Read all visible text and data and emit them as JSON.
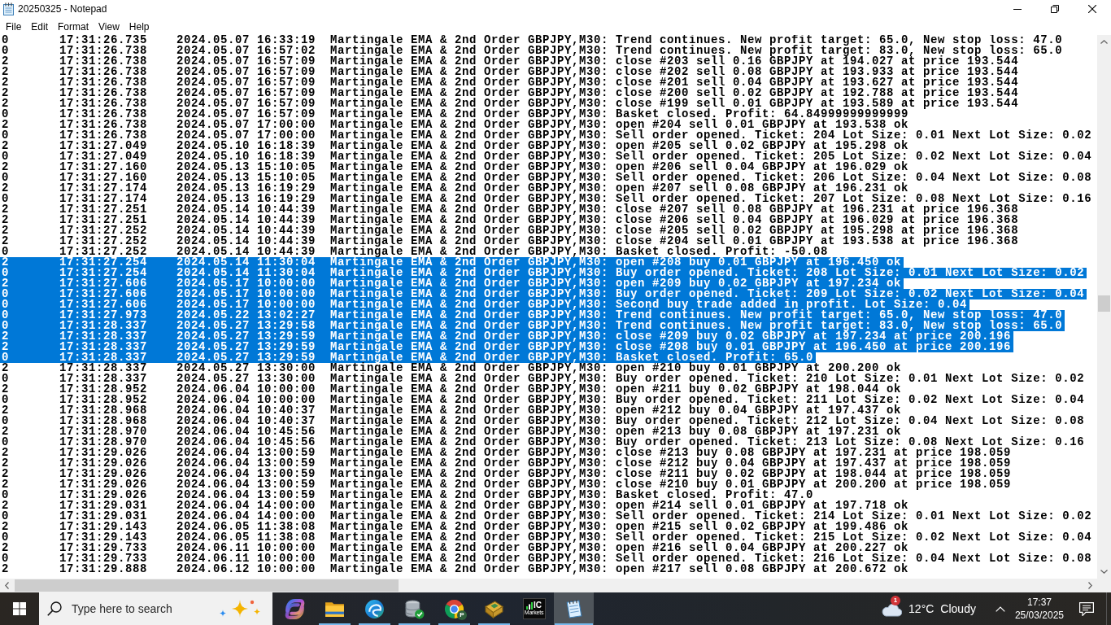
{
  "window": {
    "title": "20250325 - Notepad"
  },
  "menu": [
    "File",
    "Edit",
    "Format",
    "View",
    "Help"
  ],
  "lines": [
    {
      "code": "0",
      "time": "17:31:26.735",
      "date": "2024.05.07 16:33:19",
      "message": "Martingale EMA & 2nd Order GBPJPY,M30: Trend continues. New profit target: 65.0, New stop loss: 47.0",
      "selected": false
    },
    {
      "code": "0",
      "time": "17:31:26.738",
      "date": "2024.05.07 16:57:02",
      "message": "Martingale EMA & 2nd Order GBPJPY,M30: Trend continues. New profit target: 83.0, New stop loss: 65.0",
      "selected": false
    },
    {
      "code": "2",
      "time": "17:31:26.738",
      "date": "2024.05.07 16:57:09",
      "message": "Martingale EMA & 2nd Order GBPJPY,M30: close #203 sell 0.16 GBPJPY at 194.027 at price 193.544",
      "selected": false
    },
    {
      "code": "2",
      "time": "17:31:26.738",
      "date": "2024.05.07 16:57:09",
      "message": "Martingale EMA & 2nd Order GBPJPY,M30: close #202 sell 0.08 GBPJPY at 193.933 at price 193.544",
      "selected": false
    },
    {
      "code": "2",
      "time": "17:31:26.738",
      "date": "2024.05.07 16:57:09",
      "message": "Martingale EMA & 2nd Order GBPJPY,M30: close #201 sell 0.04 GBPJPY at 193.627 at price 193.544",
      "selected": false
    },
    {
      "code": "2",
      "time": "17:31:26.738",
      "date": "2024.05.07 16:57:09",
      "message": "Martingale EMA & 2nd Order GBPJPY,M30: close #200 sell 0.02 GBPJPY at 192.788 at price 193.544",
      "selected": false
    },
    {
      "code": "2",
      "time": "17:31:26.738",
      "date": "2024.05.07 16:57:09",
      "message": "Martingale EMA & 2nd Order GBPJPY,M30: close #199 sell 0.01 GBPJPY at 193.589 at price 193.544",
      "selected": false
    },
    {
      "code": "0",
      "time": "17:31:26.738",
      "date": "2024.05.07 16:57:09",
      "message": "Martingale EMA & 2nd Order GBPJPY,M30: Basket closed. Profit: 64.84999999999999",
      "selected": false
    },
    {
      "code": "2",
      "time": "17:31:26.738",
      "date": "2024.05.07 17:00:00",
      "message": "Martingale EMA & 2nd Order GBPJPY,M30: open #204 sell 0.01 GBPJPY at 193.538 ok",
      "selected": false
    },
    {
      "code": "0",
      "time": "17:31:26.738",
      "date": "2024.05.07 17:00:00",
      "message": "Martingale EMA & 2nd Order GBPJPY,M30: Sell order opened. Ticket: 204 Lot Size: 0.01 Next Lot Size: 0.02",
      "selected": false
    },
    {
      "code": "2",
      "time": "17:31:27.049",
      "date": "2024.05.10 16:18:39",
      "message": "Martingale EMA & 2nd Order GBPJPY,M30: open #205 sell 0.02 GBPJPY at 195.298 ok",
      "selected": false
    },
    {
      "code": "0",
      "time": "17:31:27.049",
      "date": "2024.05.10 16:18:39",
      "message": "Martingale EMA & 2nd Order GBPJPY,M30: Sell order opened. Ticket: 205 Lot Size: 0.02 Next Lot Size: 0.04",
      "selected": false
    },
    {
      "code": "2",
      "time": "17:31:27.160",
      "date": "2024.05.13 15:10:05",
      "message": "Martingale EMA & 2nd Order GBPJPY,M30: open #206 sell 0.04 GBPJPY at 196.029 ok",
      "selected": false
    },
    {
      "code": "0",
      "time": "17:31:27.160",
      "date": "2024.05.13 15:10:05",
      "message": "Martingale EMA & 2nd Order GBPJPY,M30: Sell order opened. Ticket: 206 Lot Size: 0.04 Next Lot Size: 0.08",
      "selected": false
    },
    {
      "code": "2",
      "time": "17:31:27.174",
      "date": "2024.05.13 16:19:29",
      "message": "Martingale EMA & 2nd Order GBPJPY,M30: open #207 sell 0.08 GBPJPY at 196.231 ok",
      "selected": false
    },
    {
      "code": "0",
      "time": "17:31:27.174",
      "date": "2024.05.13 16:19:29",
      "message": "Martingale EMA & 2nd Order GBPJPY,M30: Sell order opened. Ticket: 207 Lot Size: 0.08 Next Lot Size: 0.16",
      "selected": false
    },
    {
      "code": "2",
      "time": "17:31:27.251",
      "date": "2024.05.14 10:44:39",
      "message": "Martingale EMA & 2nd Order GBPJPY,M30: close #207 sell 0.08 GBPJPY at 196.231 at price 196.368",
      "selected": false
    },
    {
      "code": "2",
      "time": "17:31:27.251",
      "date": "2024.05.14 10:44:39",
      "message": "Martingale EMA & 2nd Order GBPJPY,M30: close #206 sell 0.04 GBPJPY at 196.029 at price 196.368",
      "selected": false
    },
    {
      "code": "2",
      "time": "17:31:27.252",
      "date": "2024.05.14 10:44:39",
      "message": "Martingale EMA & 2nd Order GBPJPY,M30: close #205 sell 0.02 GBPJPY at 195.298 at price 196.368",
      "selected": false
    },
    {
      "code": "2",
      "time": "17:31:27.252",
      "date": "2024.05.14 10:44:39",
      "message": "Martingale EMA & 2nd Order GBPJPY,M30: close #204 sell 0.01 GBPJPY at 193.538 at price 196.368",
      "selected": false
    },
    {
      "code": "0",
      "time": "17:31:27.252",
      "date": "2024.05.14 10:44:39",
      "message": "Martingale EMA & 2nd Order GBPJPY,M30: Basket closed. Profit: -50.08",
      "selected": false
    },
    {
      "code": "2",
      "time": "17:31:27.254",
      "date": "2024.05.14 11:30:04",
      "message": "Martingale EMA & 2nd Order GBPJPY,M30: open #208 buy 0.01 GBPJPY at 196.450 ok",
      "selected": true
    },
    {
      "code": "0",
      "time": "17:31:27.254",
      "date": "2024.05.14 11:30:04",
      "message": "Martingale EMA & 2nd Order GBPJPY,M30: Buy order opened. Ticket: 208 Lot Size: 0.01 Next Lot Size: 0.02",
      "selected": true
    },
    {
      "code": "2",
      "time": "17:31:27.606",
      "date": "2024.05.17 10:00:00",
      "message": "Martingale EMA & 2nd Order GBPJPY,M30: open #209 buy 0.02 GBPJPY at 197.234 ok",
      "selected": true
    },
    {
      "code": "0",
      "time": "17:31:27.606",
      "date": "2024.05.17 10:00:00",
      "message": "Martingale EMA & 2nd Order GBPJPY,M30: Buy order opened. Ticket: 209 Lot Size: 0.02 Next Lot Size: 0.04",
      "selected": true
    },
    {
      "code": "0",
      "time": "17:31:27.606",
      "date": "2024.05.17 10:00:00",
      "message": "Martingale EMA & 2nd Order GBPJPY,M30: Second buy trade added in profit. Lot Size: 0.04",
      "selected": true
    },
    {
      "code": "0",
      "time": "17:31:27.973",
      "date": "2024.05.22 13:02:27",
      "message": "Martingale EMA & 2nd Order GBPJPY,M30: Trend continues. New profit target: 65.0, New stop loss: 47.0",
      "selected": true
    },
    {
      "code": "0",
      "time": "17:31:28.337",
      "date": "2024.05.27 13:29:58",
      "message": "Martingale EMA & 2nd Order GBPJPY,M30: Trend continues. New profit target: 83.0, New stop loss: 65.0",
      "selected": true
    },
    {
      "code": "2",
      "time": "17:31:28.337",
      "date": "2024.05.27 13:29:59",
      "message": "Martingale EMA & 2nd Order GBPJPY,M30: close #209 buy 0.02 GBPJPY at 197.234 at price 200.196",
      "selected": true
    },
    {
      "code": "2",
      "time": "17:31:28.337",
      "date": "2024.05.27 13:29:59",
      "message": "Martingale EMA & 2nd Order GBPJPY,M30: close #208 buy 0.01 GBPJPY at 196.450 at price 200.196",
      "selected": true
    },
    {
      "code": "0",
      "time": "17:31:28.337",
      "date": "2024.05.27 13:29:59",
      "message": "Martingale EMA & 2nd Order GBPJPY,M30: Basket closed. Profit: 65.0",
      "selected": true
    },
    {
      "code": "2",
      "time": "17:31:28.337",
      "date": "2024.05.27 13:30:00",
      "message": "Martingale EMA & 2nd Order GBPJPY,M30: open #210 buy 0.01 GBPJPY at 200.200 ok",
      "selected": false
    },
    {
      "code": "0",
      "time": "17:31:28.337",
      "date": "2024.05.27 13:30:00",
      "message": "Martingale EMA & 2nd Order GBPJPY,M30: Buy order opened. Ticket: 210 Lot Size: 0.01 Next Lot Size: 0.02",
      "selected": false
    },
    {
      "code": "2",
      "time": "17:31:28.952",
      "date": "2024.06.04 10:00:00",
      "message": "Martingale EMA & 2nd Order GBPJPY,M30: open #211 buy 0.02 GBPJPY at 198.044 ok",
      "selected": false
    },
    {
      "code": "0",
      "time": "17:31:28.952",
      "date": "2024.06.04 10:00:00",
      "message": "Martingale EMA & 2nd Order GBPJPY,M30: Buy order opened. Ticket: 211 Lot Size: 0.02 Next Lot Size: 0.04",
      "selected": false
    },
    {
      "code": "2",
      "time": "17:31:28.968",
      "date": "2024.06.04 10:40:37",
      "message": "Martingale EMA & 2nd Order GBPJPY,M30: open #212 buy 0.04 GBPJPY at 197.437 ok",
      "selected": false
    },
    {
      "code": "0",
      "time": "17:31:28.968",
      "date": "2024.06.04 10:40:37",
      "message": "Martingale EMA & 2nd Order GBPJPY,M30: Buy order opened. Ticket: 212 Lot Size: 0.04 Next Lot Size: 0.08",
      "selected": false
    },
    {
      "code": "2",
      "time": "17:31:28.970",
      "date": "2024.06.04 10:45:56",
      "message": "Martingale EMA & 2nd Order GBPJPY,M30: open #213 buy 0.08 GBPJPY at 197.231 ok",
      "selected": false
    },
    {
      "code": "0",
      "time": "17:31:28.970",
      "date": "2024.06.04 10:45:56",
      "message": "Martingale EMA & 2nd Order GBPJPY,M30: Buy order opened. Ticket: 213 Lot Size: 0.08 Next Lot Size: 0.16",
      "selected": false
    },
    {
      "code": "2",
      "time": "17:31:29.026",
      "date": "2024.06.04 13:00:59",
      "message": "Martingale EMA & 2nd Order GBPJPY,M30: close #213 buy 0.08 GBPJPY at 197.231 at price 198.059",
      "selected": false
    },
    {
      "code": "2",
      "time": "17:31:29.026",
      "date": "2024.06.04 13:00:59",
      "message": "Martingale EMA & 2nd Order GBPJPY,M30: close #212 buy 0.04 GBPJPY at 197.437 at price 198.059",
      "selected": false
    },
    {
      "code": "2",
      "time": "17:31:29.026",
      "date": "2024.06.04 13:00:59",
      "message": "Martingale EMA & 2nd Order GBPJPY,M30: close #211 buy 0.02 GBPJPY at 198.044 at price 198.059",
      "selected": false
    },
    {
      "code": "2",
      "time": "17:31:29.026",
      "date": "2024.06.04 13:00:59",
      "message": "Martingale EMA & 2nd Order GBPJPY,M30: close #210 buy 0.01 GBPJPY at 200.200 at price 198.059",
      "selected": false
    },
    {
      "code": "0",
      "time": "17:31:29.026",
      "date": "2024.06.04 13:00:59",
      "message": "Martingale EMA & 2nd Order GBPJPY,M30: Basket closed. Profit: 47.0",
      "selected": false
    },
    {
      "code": "2",
      "time": "17:31:29.031",
      "date": "2024.06.04 14:00:00",
      "message": "Martingale EMA & 2nd Order GBPJPY,M30: open #214 sell 0.01 GBPJPY at 197.718 ok",
      "selected": false
    },
    {
      "code": "0",
      "time": "17:31:29.031",
      "date": "2024.06.04 14:00:00",
      "message": "Martingale EMA & 2nd Order GBPJPY,M30: Sell order opened. Ticket: 214 Lot Size: 0.01 Next Lot Size: 0.02",
      "selected": false
    },
    {
      "code": "2",
      "time": "17:31:29.143",
      "date": "2024.06.05 11:38:08",
      "message": "Martingale EMA & 2nd Order GBPJPY,M30: open #215 sell 0.02 GBPJPY at 199.486 ok",
      "selected": false
    },
    {
      "code": "0",
      "time": "17:31:29.143",
      "date": "2024.06.05 11:38:08",
      "message": "Martingale EMA & 2nd Order GBPJPY,M30: Sell order opened. Ticket: 215 Lot Size: 0.02 Next Lot Size: 0.04",
      "selected": false
    },
    {
      "code": "2",
      "time": "17:31:29.733",
      "date": "2024.06.11 10:00:00",
      "message": "Martingale EMA & 2nd Order GBPJPY,M30: open #216 sell 0.04 GBPJPY at 200.227 ok",
      "selected": false
    },
    {
      "code": "0",
      "time": "17:31:29.733",
      "date": "2024.06.11 10:00:00",
      "message": "Martingale EMA & 2nd Order GBPJPY,M30: Sell order opened. Ticket: 216 Lot Size: 0.04 Next Lot Size: 0.08",
      "selected": false
    },
    {
      "code": "2",
      "time": "17:31:29.888",
      "date": "2024.06.12 10:00:00",
      "message": "Martingale EMA & 2nd Order GBPJPY,M30: open #217 sell 0.08 GBPJPY at 200.672 ok",
      "selected": false
    }
  ],
  "taskbar": {
    "search": {
      "placeholder": "Type here to search"
    },
    "apps": [
      {
        "kind": "swirl",
        "running": false,
        "active": false
      },
      {
        "kind": "folder",
        "running": true,
        "active": false
      },
      {
        "kind": "wave",
        "running": true,
        "active": false
      },
      {
        "kind": "database",
        "running": true,
        "active": false
      },
      {
        "kind": "ring",
        "badge": "P",
        "running": true,
        "active": false
      },
      {
        "kind": "tile",
        "running": true,
        "active": false
      },
      {
        "kind": "chart",
        "logo_text": "IC",
        "logo_subtext": "Markets",
        "running": false,
        "active": false
      },
      {
        "kind": "notepad",
        "running": true,
        "active": true
      }
    ],
    "weather": {
      "badge": "1",
      "temperature": "12°C",
      "condition": "Cloudy"
    },
    "clock": {
      "time": "17:37",
      "date": "25/03/2025"
    }
  }
}
